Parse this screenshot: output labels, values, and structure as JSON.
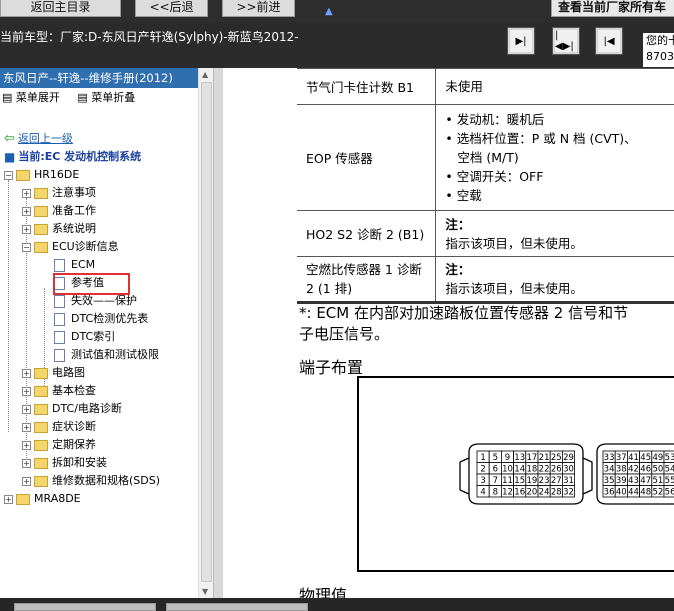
{
  "toolbar": {
    "btn_back": "返回主目录",
    "btn_prev": "<<后退",
    "btn_next": ">>前进",
    "btn_view": "查看当前厂家所有车",
    "mark": "▲"
  },
  "info": {
    "car_model": "当前车型：厂家:D-东风日产轩逸(Sylphy)-新蓝鸟2012-",
    "code_line1": "您的卡",
    "code_line2": "8703"
  },
  "nav_icons": [
    "step-forward-icon",
    "expand-icon",
    "step-back-icon"
  ],
  "sidebar": {
    "title": "东风日产--轩逸--维修手册(2012)",
    "expand_label": "菜单展开",
    "collapse_label": "菜单折叠",
    "back_label": "返回上一级",
    "current_label": "当前:EC 发动机控制系统",
    "tree": [
      {
        "label": "HR16DE"
      },
      {
        "label": "注意事项"
      },
      {
        "label": "准备工作"
      },
      {
        "label": "系统说明"
      },
      {
        "label": "ECU诊断信息"
      },
      {
        "label": "ECM"
      },
      {
        "label": "参考值"
      },
      {
        "label": "失效——保护"
      },
      {
        "label": "DTC检测优先表"
      },
      {
        "label": "DTC索引"
      },
      {
        "label": "测试值和测试极限"
      },
      {
        "label": "电路图"
      },
      {
        "label": "基本检查"
      },
      {
        "label": "DTC/电路诊断"
      },
      {
        "label": "症状诊断"
      },
      {
        "label": "定期保养"
      },
      {
        "label": "拆卸和安装"
      },
      {
        "label": "维修数据和规格(SDS)"
      },
      {
        "label": "MRA8DE"
      }
    ]
  },
  "content": {
    "rows": [
      {
        "item": "节气门卡住计数 B1",
        "cond": [
          "未使用"
        ]
      },
      {
        "item": "EOP 传感器",
        "cond": [
          "• 发动机：暖机后",
          "• 选档杆位置：P 或 N 档 (CVT)、",
          "  空档 (M/T)",
          "• 空调开关：OFF",
          "• 空载"
        ]
      },
      {
        "item": "HO2 S2 诊断 2 (B1)",
        "cond": [
          "注：",
          "指示该项目，但未使用。"
        ]
      },
      {
        "item": "空燃比传感器 1 诊断 2 (1 排)",
        "cond": [
          "注：",
          "指示该项目，但未使用。"
        ]
      }
    ],
    "footnote_line1": "*: ECM 在内部对加速踏板位置传感器 2 信号和节",
    "footnote_line2": "子电压信号。",
    "section_terminal": "端子布置",
    "section_physical": "物理值",
    "connector_a": [
      [
        "1",
        "5",
        "9",
        "13",
        "17",
        "21",
        "25",
        "29"
      ],
      [
        "2",
        "6",
        "10",
        "14",
        "18",
        "22",
        "26",
        "30"
      ],
      [
        "3",
        "7",
        "11",
        "15",
        "19",
        "23",
        "27",
        "31"
      ],
      [
        "4",
        "8",
        "12",
        "16",
        "20",
        "24",
        "28",
        "32"
      ]
    ],
    "connector_b": [
      [
        "33",
        "37",
        "41",
        "45",
        "49",
        "53"
      ],
      [
        "34",
        "38",
        "42",
        "46",
        "50",
        "54"
      ],
      [
        "35",
        "39",
        "43",
        "47",
        "51",
        "55"
      ],
      [
        "36",
        "40",
        "44",
        "48",
        "52",
        "56"
      ]
    ]
  }
}
